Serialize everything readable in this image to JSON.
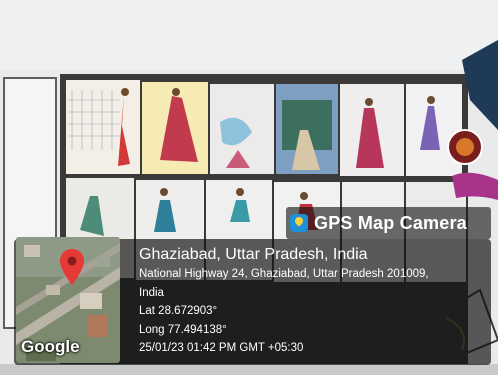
{
  "badge": {
    "title": "GPS Map Camera",
    "icon": "gps-map-camera-app-icon"
  },
  "location": {
    "city": "Ghaziabad, Uttar Pradesh, India",
    "address_line1": "National Highway 24, Ghaziabad, Uttar Pradesh 201009,",
    "address_line2": "India",
    "lat": "Lat 28.672903°",
    "long": "Long 77.494138°",
    "datetime": "25/01/23 01:42 PM GMT +05:30"
  },
  "map": {
    "provider": "Google",
    "pin_icon": "map-pin-icon",
    "pin_color": "#e53935"
  }
}
